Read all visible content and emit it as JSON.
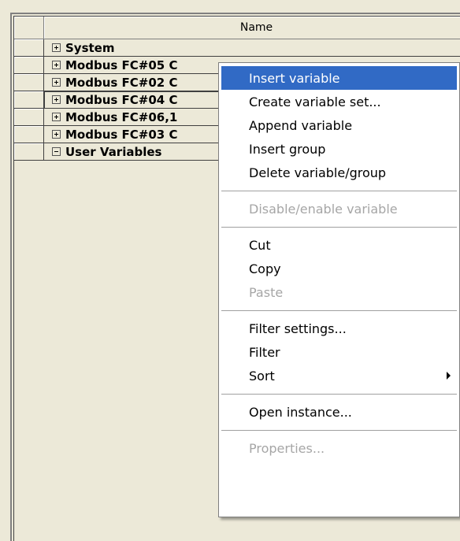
{
  "grid": {
    "header": {
      "name_label": "Name"
    },
    "rows": [
      {
        "label": "System",
        "expander": "plus"
      },
      {
        "label": "Modbus FC#05 C",
        "expander": "plus"
      },
      {
        "label": "Modbus FC#02 C",
        "expander": "plus"
      },
      {
        "label": "Modbus FC#04 C",
        "expander": "plus"
      },
      {
        "label": "Modbus FC#06,1",
        "expander": "plus"
      },
      {
        "label": "Modbus FC#03 C",
        "expander": "plus"
      },
      {
        "label": "User Variables",
        "expander": "minus"
      }
    ]
  },
  "context_menu": {
    "items": [
      {
        "label": "Insert variable",
        "state": "highlighted"
      },
      {
        "label": "Create variable set...",
        "state": "enabled"
      },
      {
        "label": "Append variable",
        "state": "enabled"
      },
      {
        "label": "Insert group",
        "state": "enabled"
      },
      {
        "label": "Delete variable/group",
        "state": "enabled"
      },
      {
        "label": "Disable/enable variable",
        "state": "disabled"
      },
      {
        "label": "Cut",
        "state": "enabled"
      },
      {
        "label": "Copy",
        "state": "enabled"
      },
      {
        "label": "Paste",
        "state": "disabled"
      },
      {
        "label": "Filter settings...",
        "state": "enabled"
      },
      {
        "label": "Filter",
        "state": "enabled"
      },
      {
        "label": "Sort",
        "state": "enabled",
        "submenu": true
      },
      {
        "label": "Open instance...",
        "state": "enabled"
      },
      {
        "label": "Properties...",
        "state": "disabled"
      }
    ]
  },
  "colors": {
    "highlight": "#316ac5",
    "disabled_text": "#a6a6a6",
    "window_face": "#ece9d8"
  }
}
